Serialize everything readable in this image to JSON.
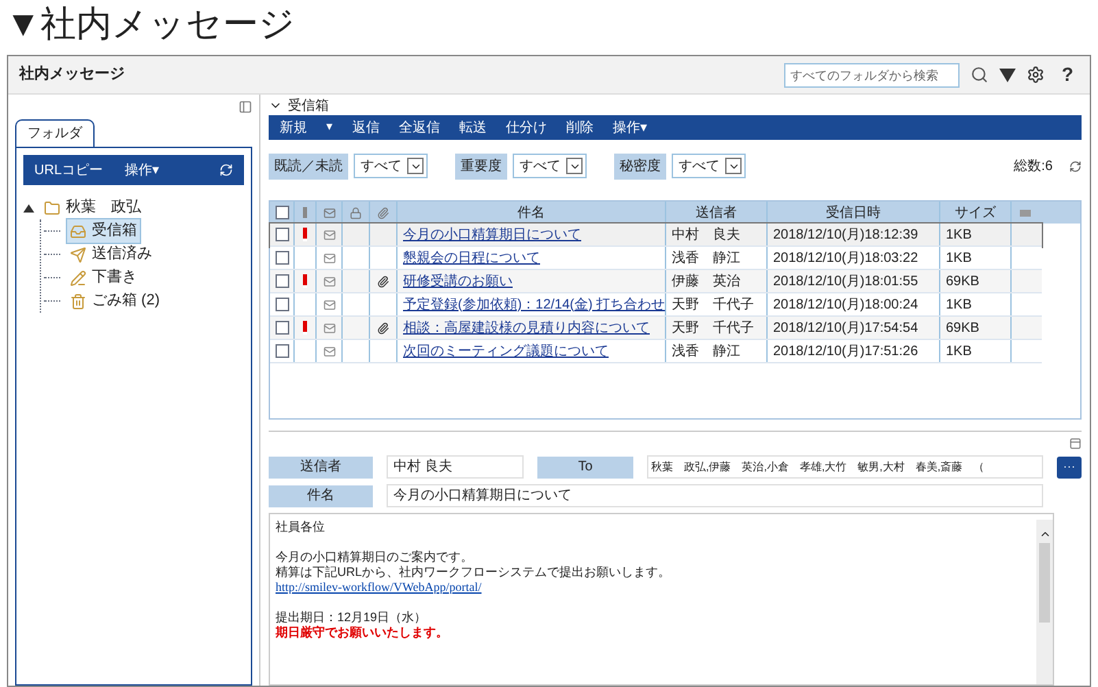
{
  "page_title": "▼社内メッセージ",
  "window": {
    "title": "社内メッセージ",
    "search": {
      "placeholder": "すべてのフォルダから検索"
    },
    "help": "?"
  },
  "folder_tab": {
    "label": "フォルダ",
    "selected": true
  },
  "folder_toolbar": [
    "URLコピー",
    "操作▾"
  ],
  "tree": [
    {
      "label": "秋葉　政弘",
      "kind": "user",
      "expanded": true,
      "selected": false,
      "children": [
        {
          "label": "受信箱",
          "kind": "inbox",
          "selected": true
        },
        {
          "label": "送信済み",
          "kind": "sent",
          "selected": false
        },
        {
          "label": "下書き",
          "kind": "draft",
          "selected": false
        },
        {
          "label": "ごみ箱 (2)",
          "kind": "trash",
          "selected": false
        }
      ]
    }
  ],
  "folder_heading": "受信箱",
  "toolbar": [
    {
      "label": "新規",
      "kind": "button"
    },
    {
      "label": "▾",
      "kind": "caret"
    },
    {
      "label": "返信",
      "kind": "button"
    },
    {
      "label": "全返信",
      "kind": "button"
    },
    {
      "label": "転送",
      "kind": "button"
    },
    {
      "label": "仕分け",
      "kind": "button"
    },
    {
      "label": "削除",
      "kind": "button"
    },
    {
      "label": "操作▾",
      "kind": "button"
    }
  ],
  "filters": [
    {
      "label": "既読／未読",
      "value": "すべて"
    },
    {
      "label": "重要度",
      "value": "すべて"
    },
    {
      "label": "秘密度",
      "value": "すべて"
    }
  ],
  "total": "総数:6",
  "table": {
    "header_checked": false,
    "columns": [
      "件名",
      "送信者",
      "受信日時",
      "サイズ"
    ],
    "rows": [
      {
        "checked": false,
        "important": true,
        "attachment": false,
        "selected": true,
        "subject": "今月の小口精算期日について",
        "sender": "中村　良夫",
        "date": "2018/12/10(月)18:12:39",
        "size": "1KB"
      },
      {
        "checked": false,
        "important": false,
        "attachment": false,
        "selected": false,
        "subject": "懇親会の日程について",
        "sender": "浅香　静江",
        "date": "2018/12/10(月)18:03:22",
        "size": "1KB"
      },
      {
        "checked": false,
        "important": true,
        "attachment": true,
        "selected": false,
        "subject": "研修受講のお願い",
        "sender": "伊藤　英治",
        "date": "2018/12/10(月)18:01:55",
        "size": "69KB"
      },
      {
        "checked": false,
        "important": false,
        "attachment": false,
        "selected": false,
        "subject": "予定登録(参加依頼)：12/14(金) 打ち合わせ",
        "sender": "天野　千代子",
        "date": "2018/12/10(月)18:00:24",
        "size": "1KB"
      },
      {
        "checked": false,
        "important": true,
        "attachment": true,
        "selected": false,
        "subject": "相談：高屋建設様の見積り内容について",
        "sender": "天野　千代子",
        "date": "2018/12/10(月)17:54:54",
        "size": "69KB"
      },
      {
        "checked": false,
        "important": false,
        "attachment": false,
        "selected": false,
        "subject": "次回のミーティング議題について",
        "sender": "浅香　静江",
        "date": "2018/12/10(月)17:51:26",
        "size": "1KB"
      }
    ]
  },
  "preview": {
    "sender_label": "送信者",
    "sender": "中村  良夫",
    "to_label": "To",
    "to": "秋葉　政弘,伊藤　英治,小倉　孝雄,大竹　敏男,大村　春美,斎藤　（",
    "more": "···",
    "subject_label": "件名",
    "subject": "今月の小口精算期日について",
    "body": [
      {
        "kind": "text",
        "text": "社員各位"
      },
      {
        "kind": "blank"
      },
      {
        "kind": "text",
        "text": "今月の小口精算期日のご案内です。"
      },
      {
        "kind": "text",
        "text": "精算は下記URLから、社内ワークフローシステムで提出お願いします。"
      },
      {
        "kind": "link",
        "text": "http://smilev-workflow/VWebApp/portal/"
      },
      {
        "kind": "blank"
      },
      {
        "kind": "text",
        "text": "提出期日：12月19日（水）"
      },
      {
        "kind": "alert",
        "text": "期日厳守でお願いいたします。"
      }
    ]
  }
}
